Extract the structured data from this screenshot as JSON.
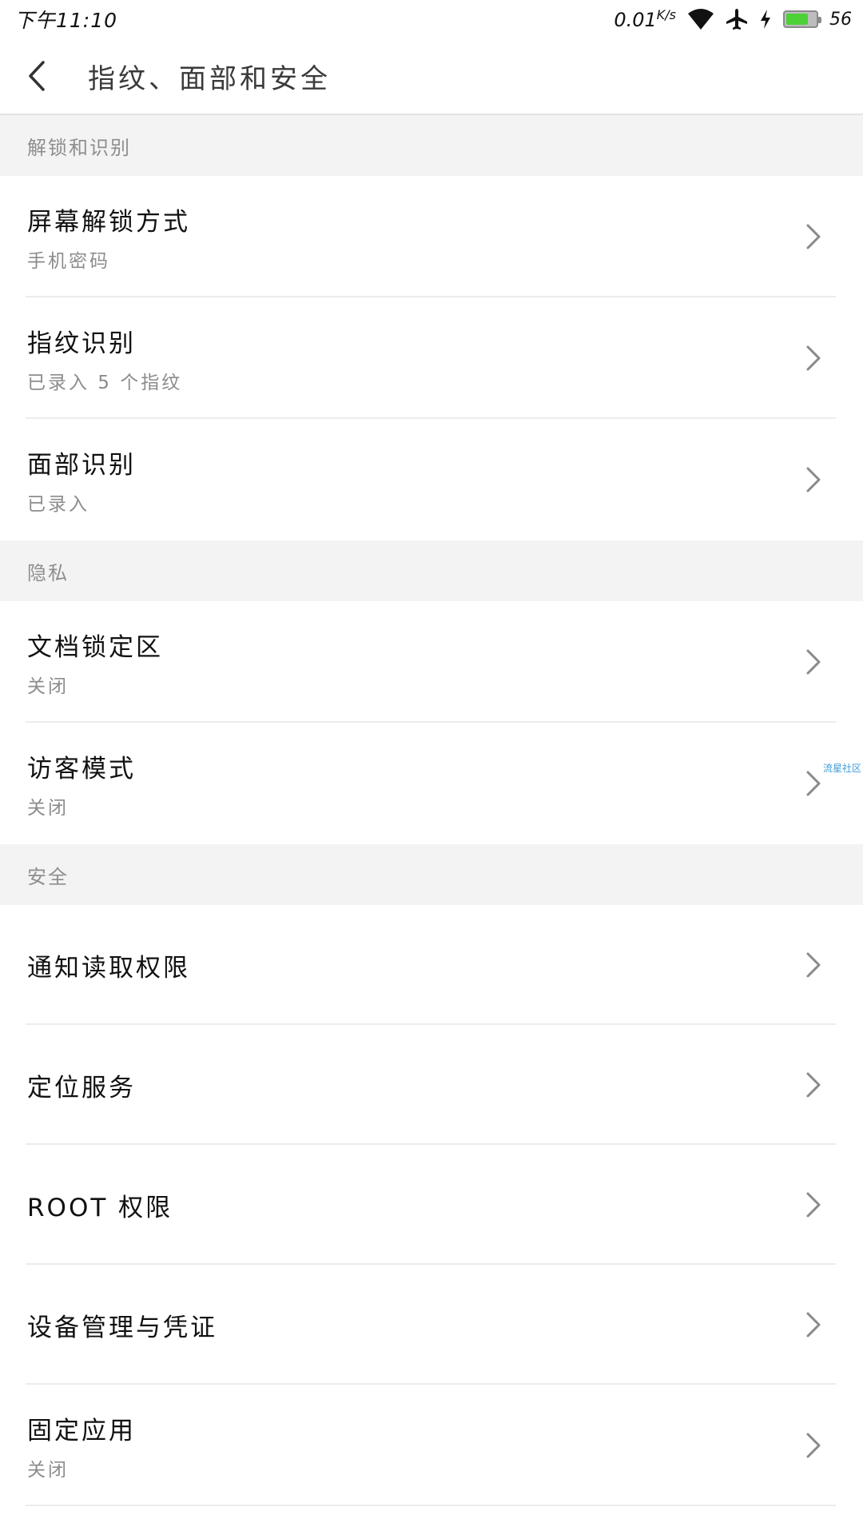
{
  "status_bar": {
    "time": "下午11:10",
    "net_speed_value": "0.01",
    "net_speed_unit": "K/s",
    "battery_level": "56",
    "icons": [
      "wifi-icon",
      "airplane-icon",
      "charging-icon",
      "battery-icon"
    ],
    "battery_color": "#4cd137"
  },
  "header": {
    "title": "指纹、面部和安全",
    "back_icon": "chevron-left-icon"
  },
  "sections": [
    {
      "label": "解锁和识别",
      "items": [
        {
          "title": "屏幕解锁方式",
          "subtitle": "手机密码"
        },
        {
          "title": "指纹识别",
          "subtitle": "已录入 5 个指纹"
        },
        {
          "title": "面部识别",
          "subtitle": "已录入"
        }
      ]
    },
    {
      "label": "隐私",
      "items": [
        {
          "title": "文档锁定区",
          "subtitle": "关闭"
        },
        {
          "title": "访客模式",
          "subtitle": "关闭"
        }
      ]
    },
    {
      "label": "安全",
      "items": [
        {
          "title": "通知读取权限"
        },
        {
          "title": "定位服务"
        },
        {
          "title": "ROOT 权限"
        },
        {
          "title": "设备管理与凭证"
        },
        {
          "title": "固定应用",
          "subtitle": "关闭"
        }
      ]
    }
  ],
  "watermark": "流星社区"
}
